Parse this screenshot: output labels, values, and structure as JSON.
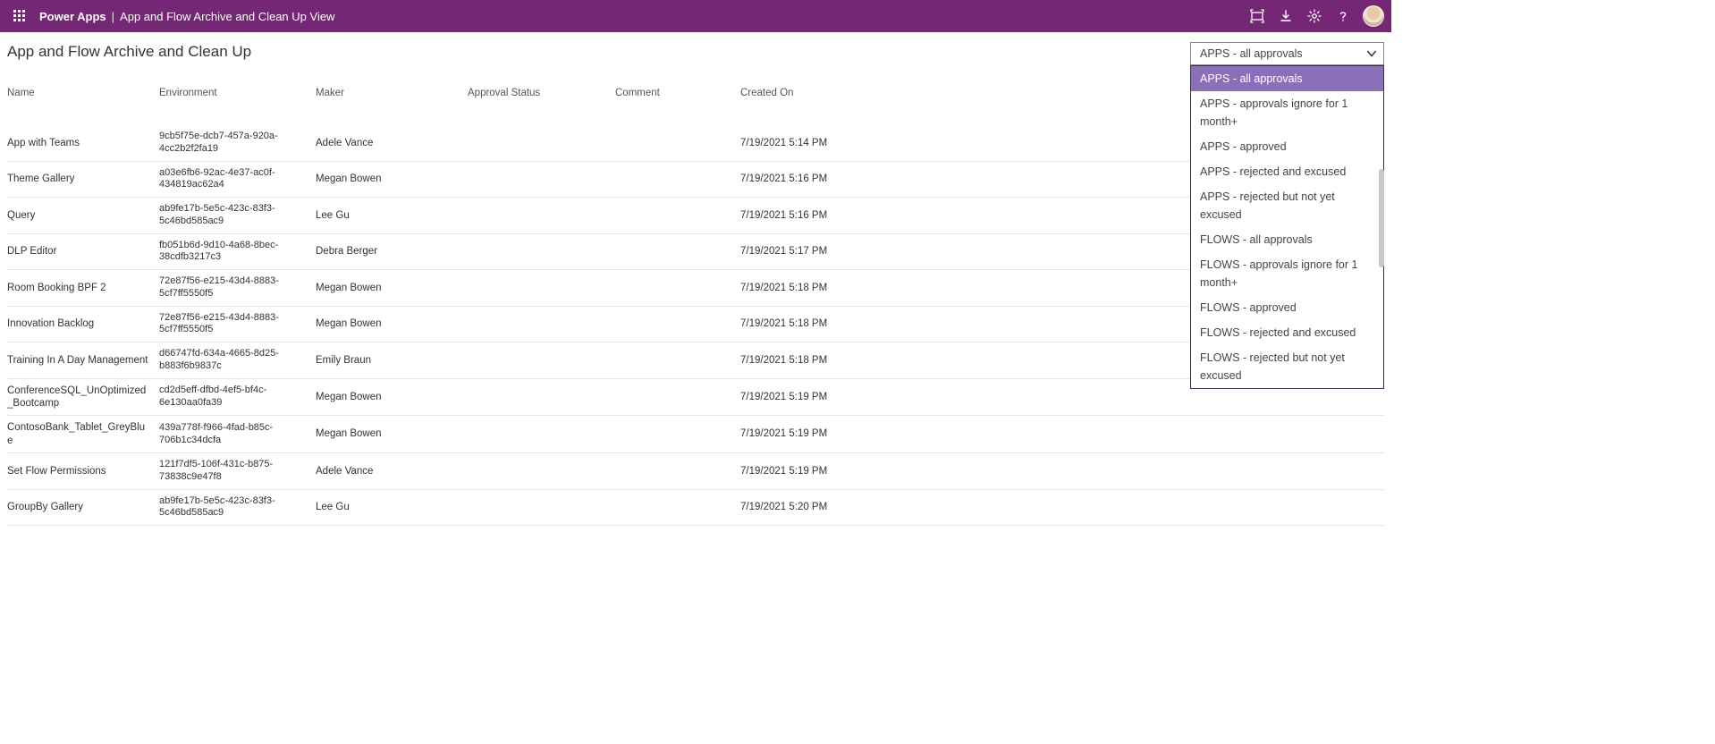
{
  "header": {
    "brand": "Power Apps",
    "app_title": "App and Flow Archive and Clean Up View"
  },
  "page_title": "App and Flow Archive and Clean Up",
  "filter": {
    "selected": "APPS - all approvals",
    "options": [
      "APPS - all approvals",
      "APPS - approvals ignore for 1 month+",
      "APPS - approved",
      "APPS - rejected and excused",
      "APPS - rejected but not yet excused",
      "FLOWS - all approvals",
      "FLOWS - approvals ignore for 1 month+",
      "FLOWS - approved",
      "FLOWS - rejected and excused",
      "FLOWS - rejected but not yet excused"
    ]
  },
  "columns": [
    "Name",
    "Environment",
    "Maker",
    "Approval Status",
    "Comment",
    "Created On"
  ],
  "rows": [
    {
      "name": "App with Teams",
      "env": "9cb5f75e-dcb7-457a-920a-4cc2b2f2fa19",
      "maker": "Adele Vance",
      "status": "",
      "comment": "",
      "created": "7/19/2021 5:14 PM"
    },
    {
      "name": "Theme Gallery",
      "env": "a03e6fb6-92ac-4e37-ac0f-434819ac62a4",
      "maker": "Megan Bowen",
      "status": "",
      "comment": "",
      "created": "7/19/2021 5:16 PM"
    },
    {
      "name": "Query",
      "env": "ab9fe17b-5e5c-423c-83f3-5c46bd585ac9",
      "maker": "Lee Gu",
      "status": "",
      "comment": "",
      "created": "7/19/2021 5:16 PM"
    },
    {
      "name": "DLP Editor",
      "env": "fb051b6d-9d10-4a68-8bec-38cdfb3217c3",
      "maker": "Debra Berger",
      "status": "",
      "comment": "",
      "created": "7/19/2021 5:17 PM"
    },
    {
      "name": "Room Booking BPF 2",
      "env": "72e87f56-e215-43d4-8883-5cf7ff5550f5",
      "maker": "Megan Bowen",
      "status": "",
      "comment": "",
      "created": "7/19/2021 5:18 PM"
    },
    {
      "name": "Innovation Backlog",
      "env": "72e87f56-e215-43d4-8883-5cf7ff5550f5",
      "maker": "Megan Bowen",
      "status": "",
      "comment": "",
      "created": "7/19/2021 5:18 PM"
    },
    {
      "name": "Training In A Day Management",
      "env": "d66747fd-634a-4665-8d25-b883f6b9837c",
      "maker": "Emily Braun",
      "status": "",
      "comment": "",
      "created": "7/19/2021 5:18 PM"
    },
    {
      "name": "ConferenceSQL_UnOptimized_Bootcamp",
      "env": "cd2d5eff-dfbd-4ef5-bf4c-6e130aa0fa39",
      "maker": "Megan Bowen",
      "status": "",
      "comment": "",
      "created": "7/19/2021 5:19 PM"
    },
    {
      "name": "ContosoBank_Tablet_GreyBlue",
      "env": "439a778f-f966-4fad-b85c-706b1c34dcfa",
      "maker": "Megan Bowen",
      "status": "",
      "comment": "",
      "created": "7/19/2021 5:19 PM"
    },
    {
      "name": "Set Flow Permissions",
      "env": "121f7df5-106f-431c-b875-73838c9e47f8",
      "maker": "Adele Vance",
      "status": "",
      "comment": "",
      "created": "7/19/2021 5:19 PM"
    },
    {
      "name": "GroupBy Gallery",
      "env": "ab9fe17b-5e5c-423c-83f3-5c46bd585ac9",
      "maker": "Lee Gu",
      "status": "",
      "comment": "",
      "created": "7/19/2021 5:20 PM"
    }
  ]
}
